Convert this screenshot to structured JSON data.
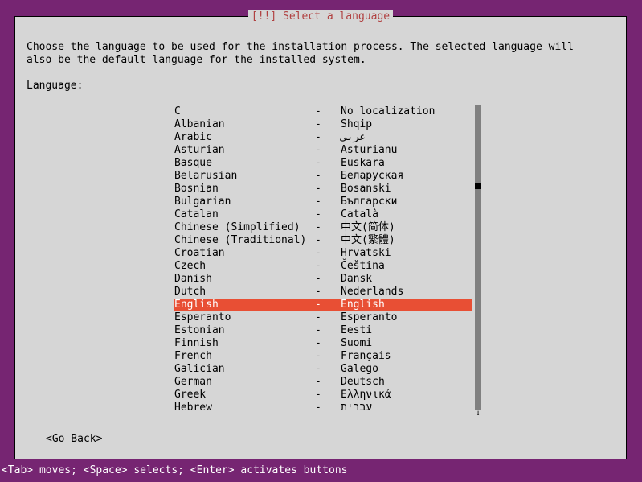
{
  "title": "[!!] Select a language",
  "body_text": "Choose the language to be used for the installation process. The selected language will\nalso be the default language for the installed system.",
  "label": "Language:",
  "separator": "-",
  "selected_index": 15,
  "languages": [
    {
      "name": "C",
      "native": "No localization"
    },
    {
      "name": "Albanian",
      "native": "Shqip"
    },
    {
      "name": "Arabic",
      "native": "عربي"
    },
    {
      "name": "Asturian",
      "native": "Asturianu"
    },
    {
      "name": "Basque",
      "native": "Euskara"
    },
    {
      "name": "Belarusian",
      "native": "Беларуская"
    },
    {
      "name": "Bosnian",
      "native": "Bosanski"
    },
    {
      "name": "Bulgarian",
      "native": "Български"
    },
    {
      "name": "Catalan",
      "native": "Català"
    },
    {
      "name": "Chinese (Simplified)",
      "native": "中文(简体)"
    },
    {
      "name": "Chinese (Traditional)",
      "native": "中文(繁體)"
    },
    {
      "name": "Croatian",
      "native": "Hrvatski"
    },
    {
      "name": "Czech",
      "native": "Čeština"
    },
    {
      "name": "Danish",
      "native": "Dansk"
    },
    {
      "name": "Dutch",
      "native": "Nederlands"
    },
    {
      "name": "English",
      "native": "English"
    },
    {
      "name": "Esperanto",
      "native": "Esperanto"
    },
    {
      "name": "Estonian",
      "native": "Eesti"
    },
    {
      "name": "Finnish",
      "native": "Suomi"
    },
    {
      "name": "French",
      "native": "Français"
    },
    {
      "name": "Galician",
      "native": "Galego"
    },
    {
      "name": "German",
      "native": "Deutsch"
    },
    {
      "name": "Greek",
      "native": "Ελληνικά"
    },
    {
      "name": "Hebrew",
      "native": "עברית"
    }
  ],
  "go_back": "<Go Back>",
  "statusbar": "<Tab> moves; <Space> selects; <Enter> activates buttons",
  "scroll": {
    "up": "↑",
    "down": "↓"
  }
}
